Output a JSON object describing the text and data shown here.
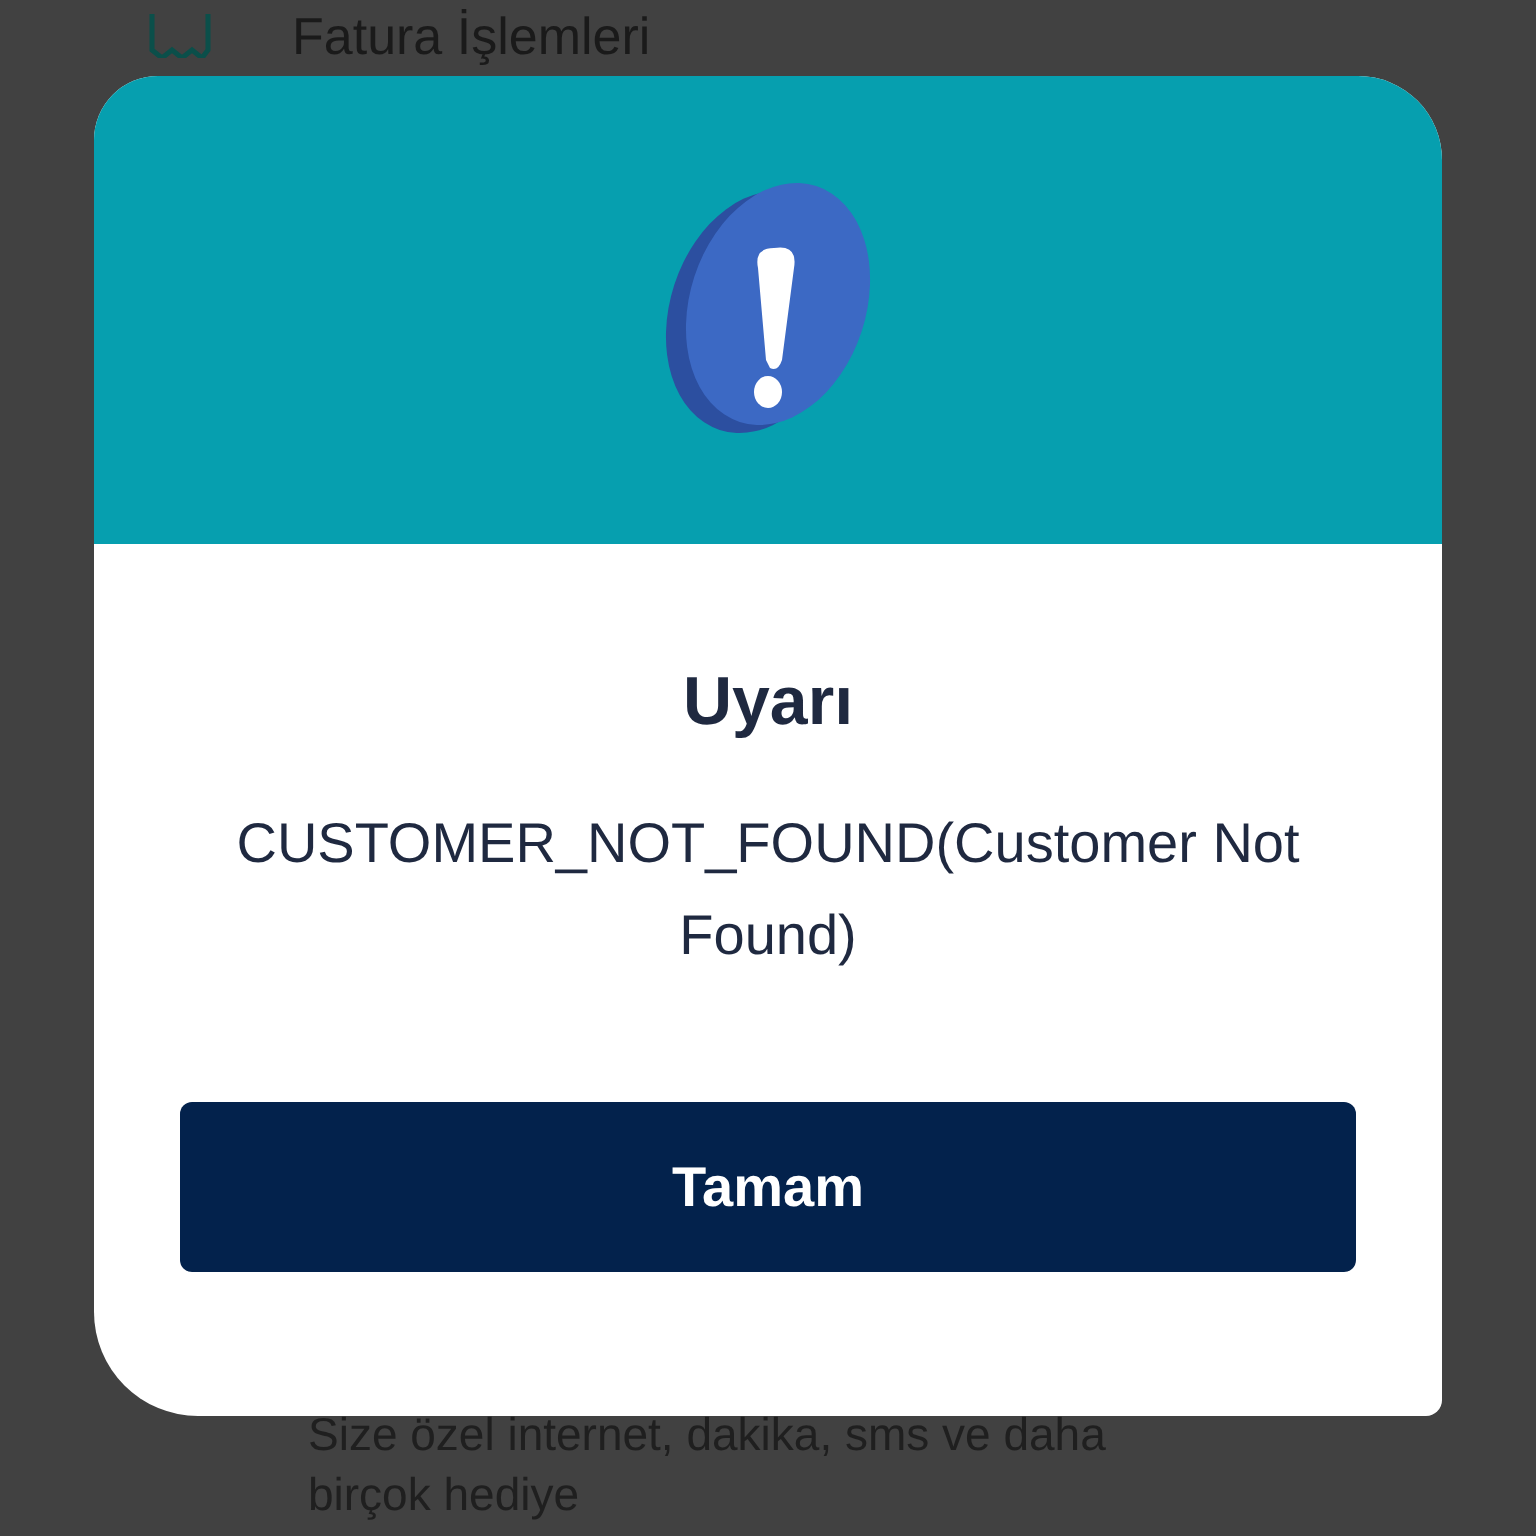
{
  "background": {
    "section_title": "Fatura İşlemleri",
    "description_lines": [
      "Size özel internet, dakika, sms ve daha",
      "birçok hediye"
    ]
  },
  "dialog": {
    "title": "Uyarı",
    "message": "CUSTOMER_NOT_FOUND(Customer Not Found)",
    "button": "Tamam"
  }
}
